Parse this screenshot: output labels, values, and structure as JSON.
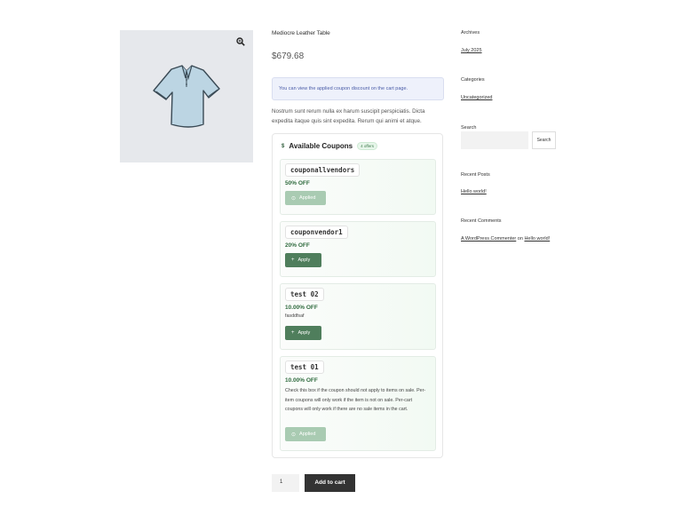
{
  "product": {
    "title": "Mediocre Leather Table",
    "price": "$679.68",
    "notice": "You can view the applied coupon discount on the cart page.",
    "description": "Nostrum sunt rerum nulla ex harum suscipit perspiciatis. Dicta expedita itaque quis sint expedita. Rerum qui animi et atque."
  },
  "coupons": {
    "icon": "$",
    "title": "Available Coupons",
    "badge": "4 offers",
    "items": [
      {
        "code": "couponallvendors",
        "off": "50% OFF",
        "desc": "",
        "button": "Applied",
        "state": "applied"
      },
      {
        "code": "couponvendor1",
        "off": "20% OFF",
        "desc": "",
        "button": "Apply",
        "state": "available"
      },
      {
        "code": "test 02",
        "off": "10.00% OFF",
        "desc": "fasddfsaf",
        "button": "Apply",
        "state": "available"
      },
      {
        "code": "test 01",
        "off": "10.00% OFF",
        "desc": "Check this box if the coupon should not apply to items on sale. Per-item coupons will only work if the item is not on sale. Per-cart coupons will only work if there are no sale items in the cart.",
        "button": "Applied",
        "state": "applied"
      }
    ]
  },
  "cart": {
    "quantity": "1",
    "add_label": "Add to cart"
  },
  "sidebar": {
    "archives_title": "Archives",
    "archives_link": "July 2025",
    "categories_title": "Categories",
    "categories_link": "Uncategorized",
    "search_title": "Search",
    "search_button": "Search",
    "recent_posts_title": "Recent Posts",
    "recent_post_link": "Hello world!",
    "recent_comments_title": "Recent Comments",
    "comment_author": "A WordPress Commenter",
    "comment_on": "on",
    "comment_post": "Hello world!"
  },
  "colors": {
    "accent_green": "#4f7e5c",
    "applied_green": "#a9cbb2",
    "notice_bg": "#eef1fb",
    "button_dark": "#333333"
  },
  "icons": [
    "zoom-icon",
    "tshirt-image",
    "dollar-icon",
    "check-circle-icon",
    "plus-icon"
  ]
}
